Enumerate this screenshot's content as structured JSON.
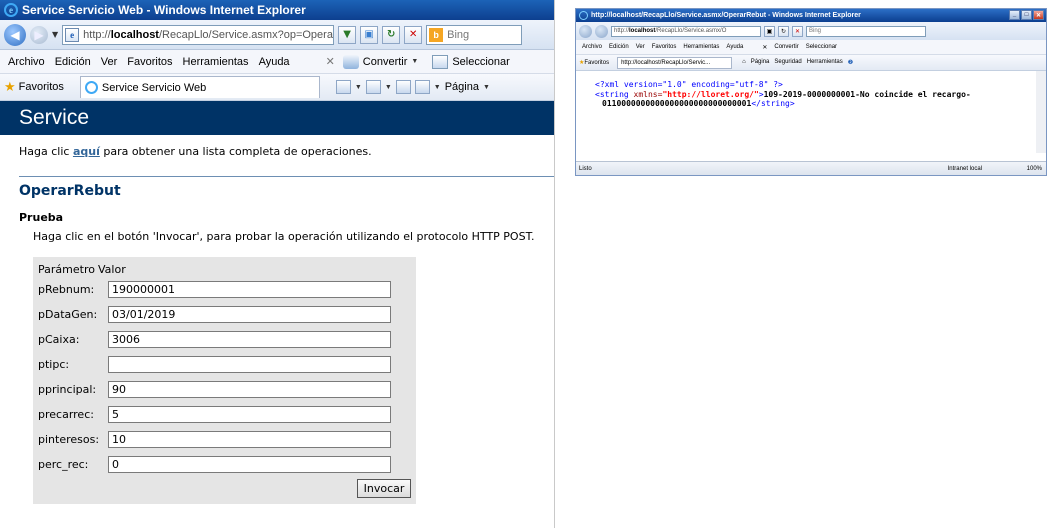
{
  "left_window": {
    "title": "Service Servicio Web - Windows Internet Explorer",
    "address": {
      "url_prefix": "http://",
      "url_host": "localhost",
      "url_path": "/RecapLlo/Service.asmx?op=OperarRebut"
    },
    "search": {
      "provider": "Bing"
    },
    "menu": {
      "items": [
        "Archivo",
        "Edición",
        "Ver",
        "Favoritos",
        "Herramientas",
        "Ayuda"
      ],
      "convertir": "Convertir",
      "seleccionar": "Seleccionar"
    },
    "favorites_bar": {
      "favoritos": "Favoritos",
      "tab_title": "Service Servicio Web",
      "pagina": "Página"
    },
    "page": {
      "header": "Service",
      "intro_before": "Haga clic ",
      "intro_link": "aquí",
      "intro_after": " para obtener una lista completa de operaciones.",
      "operation": "OperarRebut",
      "section": "Prueba",
      "description": "Haga clic en el botón 'Invocar', para probar la operación utilizando el protocolo HTTP POST.",
      "table": {
        "col_param": "Parámetro",
        "col_value": "Valor",
        "rows": [
          {
            "label": "pRebnum:",
            "value": "190000001"
          },
          {
            "label": "pDataGen:",
            "value": "03/01/2019"
          },
          {
            "label": "pCaixa:",
            "value": "3006"
          },
          {
            "label": "ptipc:",
            "value": ""
          },
          {
            "label": "pprincipal:",
            "value": "90"
          },
          {
            "label": "precarrec:",
            "value": "5"
          },
          {
            "label": "pinteresos:",
            "value": "10"
          },
          {
            "label": "perc_rec:",
            "value": "0"
          }
        ]
      },
      "invoke_label": "Invocar"
    }
  },
  "right_window": {
    "title": "http://localhost/RecapLlo/Service.asmx/OperarRebut - Windows Internet Explorer",
    "address": {
      "url_prefix": "http://",
      "url_host": "localhost",
      "url_path": "/RecapLlo/Service.asmx/O"
    },
    "search": {
      "provider": "Bing"
    },
    "menu": {
      "items": [
        "Archivo",
        "Edición",
        "Ver",
        "Favoritos",
        "Herramientas",
        "Ayuda"
      ],
      "convertir": "Convertir",
      "seleccionar": "Seleccionar"
    },
    "favorites_bar": {
      "favoritos": "Favoritos",
      "tab_title": "http://localhost/RecapLlo/Servic...",
      "pagina": "Página",
      "seguridad": "Seguridad",
      "herramientas": "Herramientas"
    },
    "xml": {
      "declaration": "<?xml version=\"1.0\" encoding=\"utf-8\" ?>",
      "open_tag": "<string",
      "attr_name": " xmlns=",
      "attr_value": "\"http://lloret.org/\"",
      "open_tag_end": ">",
      "text_line1": "109-2019-0000000001-No coincide el recargo-",
      "text_line2": "0110000000000000000000000000001",
      "close_tag": "</string>"
    },
    "status": {
      "left": "Listo",
      "zone": "Intranet local",
      "zoom": "100%"
    }
  }
}
